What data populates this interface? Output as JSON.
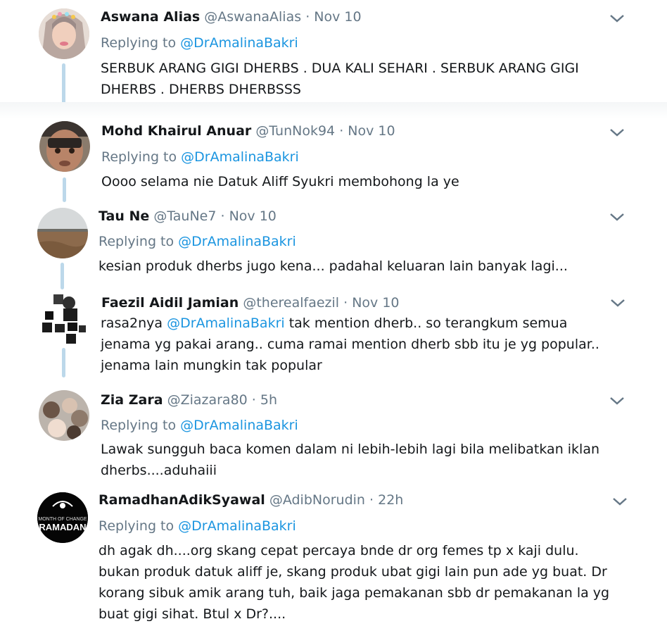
{
  "reply_prefix": "Replying to",
  "tweets": [
    {
      "name": "Aswana Alias",
      "handle": "@AswanaAlias",
      "time": "Nov 10",
      "reply_to": "@DrAmalinaBakri",
      "text": "SERBUK ARANG GIGI DHERBS . DUA KALI SEHARI . SERBUK ARANG GIGI DHERBS . DHERBS DHERBSSS"
    },
    {
      "name": "Mohd Khairul Anuar",
      "handle": "@TunNok94",
      "time": "Nov 10",
      "reply_to": "@DrAmalinaBakri",
      "text": "Oooo selama nie Datuk Aliff Syukri membohong la ye"
    },
    {
      "name": "Tau Ne",
      "handle": "@TauNe7",
      "time": "Nov 10",
      "reply_to": "@DrAmalinaBakri",
      "text": "kesian produk dherbs jugo kena... padahal keluaran lain banyak lagi..."
    },
    {
      "name": "Faezil Aidil Jamian",
      "handle": "@therealfaezil",
      "time": "Nov 10",
      "text_prefix": "rasa2nya ",
      "text_mention": "@DrAmalinaBakri",
      "text_rest": " tak mention dherb.. so terangkum semua jenama yg pakai arang.. cuma ramai mention dherb sbb itu je yg popular.. jenama lain mungkin tak popular"
    },
    {
      "name": "Zia Zara",
      "handle": "@Ziazara80",
      "time": "5h",
      "reply_to": "@DrAmalinaBakri",
      "text": "Lawak sungguh baca komen dalam ni lebih-lebih lagi bila melibatkan iklan dherbs....aduhaiii"
    },
    {
      "name": "RamadhanAdikSyawal",
      "handle": "@AdibNorudin",
      "time": "22h",
      "reply_to": "@DrAmalinaBakri",
      "avatar_text_top": "MONTH OF CHANGE",
      "avatar_text_bottom": "RAMADAN",
      "text": "dh agak dh....org skang cepat percaya bnde dr org femes tp x kaji dulu. bukan produk datuk aliff je, skang produk ubat gigi lain pun ade yg buat. Dr korang sibuk amik arang tuh, baik jaga pemakanan sbb dr pemakanan la yg buat gigi sihat. Btul x Dr?...."
    }
  ],
  "colors": {
    "link": "#1b95e0",
    "muted": "#657786",
    "thread_line": "#bcd8ea"
  }
}
